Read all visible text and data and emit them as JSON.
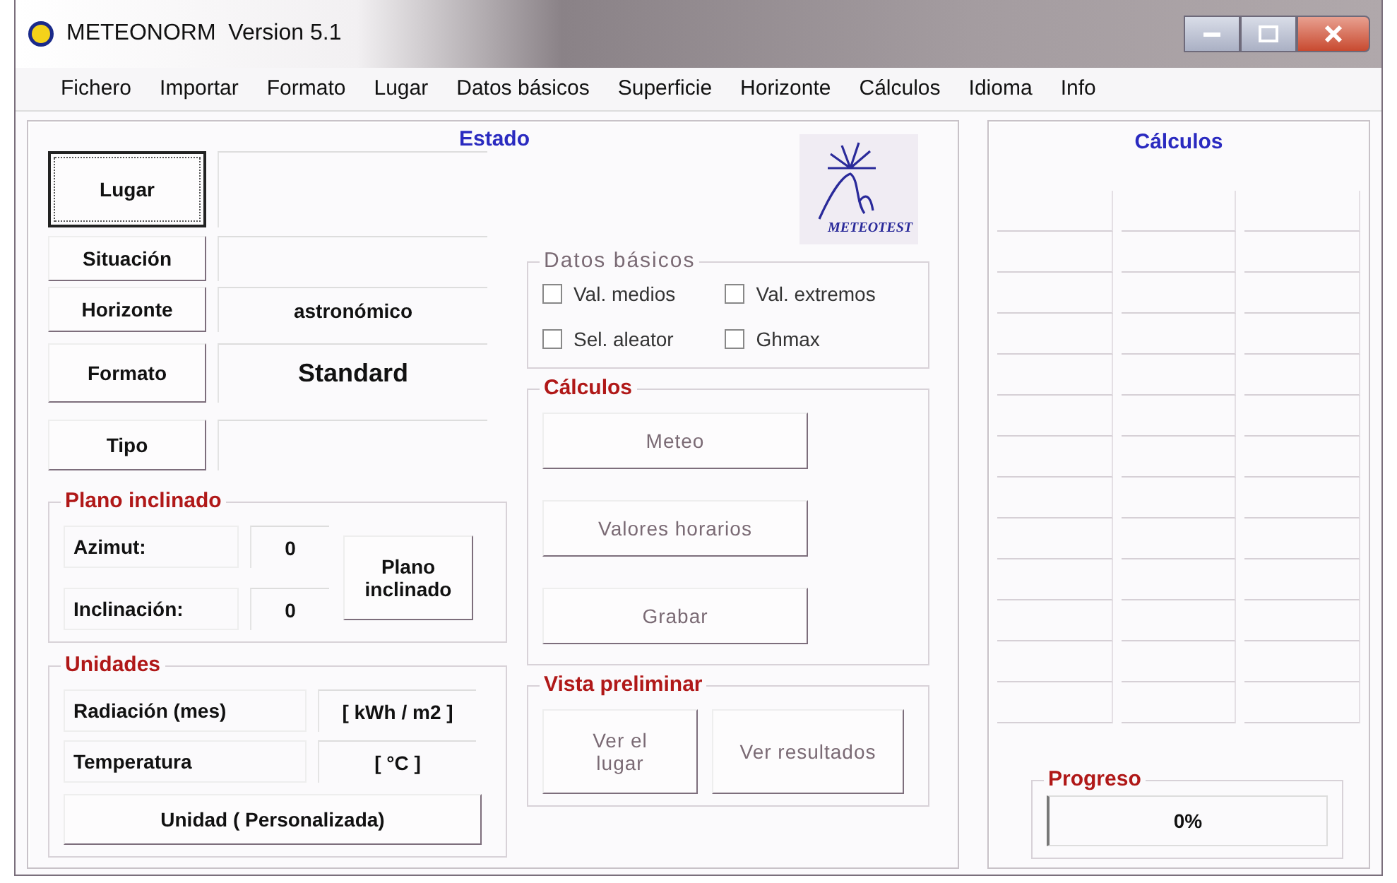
{
  "window": {
    "title": "METEONORM  Version 5.1"
  },
  "menu": [
    "Fichero",
    "Importar",
    "Formato",
    "Lugar",
    "Datos básicos",
    "Superficie",
    "Horizonte",
    "Cálculos",
    "Idioma",
    "Info"
  ],
  "estado": {
    "title": "Estado",
    "rows": [
      {
        "button": "Lugar",
        "focused": true
      },
      {
        "button": "Situación",
        "focused": false
      },
      {
        "button": "Horizonte",
        "focused": false,
        "value": "astronómico"
      },
      {
        "button": "Formato",
        "focused": false,
        "value": "Standard"
      },
      {
        "button": "Tipo",
        "focused": false
      }
    ]
  },
  "logo": {
    "text": "METEOTEST"
  },
  "datos_basicos": {
    "title": "Datos básicos",
    "options": [
      {
        "label": "Val. medios",
        "checked": false
      },
      {
        "label": "Val. extremos",
        "checked": false
      },
      {
        "label": "Sel. aleator",
        "checked": false
      },
      {
        "label": "Ghmax",
        "checked": false
      }
    ]
  },
  "plano_inclinado": {
    "title": "Plano inclinado",
    "fields": [
      {
        "label": "Azimut:",
        "value": "0"
      },
      {
        "label": "Inclinación:",
        "value": "0"
      }
    ],
    "button": "Plano inclinado"
  },
  "unidades": {
    "title": "Unidades",
    "rows": [
      {
        "label": "Radiación (mes)",
        "value": "[ kWh / m2 ]"
      },
      {
        "label": "Temperatura",
        "value": "[ °C ]"
      }
    ],
    "button": "Unidad ( Personalizada)"
  },
  "calculos": {
    "title": "Cálculos",
    "buttons": [
      {
        "label": "Meteo",
        "disabled": true
      },
      {
        "label": "Valores horarios",
        "disabled": true
      },
      {
        "label": "Grabar",
        "disabled": true
      }
    ]
  },
  "vista_preliminar": {
    "title": "Vista preliminar",
    "buttons": [
      {
        "label": "Ver el lugar",
        "disabled": true
      },
      {
        "label": "Ver resultados",
        "disabled": true
      }
    ]
  },
  "results": {
    "title": "Cálculos"
  },
  "progress": {
    "title": "Progreso",
    "reading": "0%"
  }
}
